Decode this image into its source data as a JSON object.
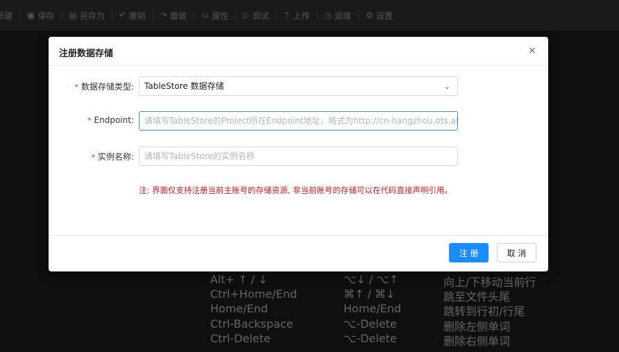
{
  "toolbar": {
    "items": [
      {
        "label": "新建",
        "icon": ""
      },
      {
        "label": "保存",
        "icon": "save-icon"
      },
      {
        "label": "另存为",
        "icon": "save-as-icon"
      },
      {
        "label": "撤销",
        "icon": "undo-icon"
      },
      {
        "label": "重做",
        "icon": "redo-icon"
      },
      {
        "label": "属性",
        "icon": "properties-icon"
      },
      {
        "label": "调试",
        "icon": "debug-icon"
      },
      {
        "label": "上传",
        "icon": "upload-icon"
      },
      {
        "label": "运维",
        "icon": "ops-icon"
      },
      {
        "label": "设置",
        "icon": "gear-icon"
      }
    ]
  },
  "shortcuts": [
    {
      "win": "Alt+ ↑ / ↓",
      "mac": "⌥↓ / ⌥↑",
      "desc": "向上/下移动当前行"
    },
    {
      "win": "Ctrl+Home/End",
      "mac": "⌘↑ / ⌘↓",
      "desc": "跳至文件头尾"
    },
    {
      "win": "Home/End",
      "mac": "Home/End",
      "desc": "跳转到行初/行尾"
    },
    {
      "win": "Ctrl-Backspace",
      "mac": "⌥-Delete",
      "desc": "删除左侧单词"
    },
    {
      "win": "Ctrl-Delete",
      "mac": "⌥-Delete",
      "desc": "删除右侧单词"
    }
  ],
  "dialog": {
    "title": "注册数据存储",
    "close_symbol": "×",
    "fields": {
      "storage_type": {
        "label": "数据存储类型:",
        "value": "TableStore 数据存储"
      },
      "endpoint": {
        "label": "Endpoint:",
        "placeholder": "请填写TableStore的Project所在Endpoint地址，格式为http://cn-hangzhou.ots.aliyuncs.com"
      },
      "instance_name": {
        "label": "实例名称:",
        "placeholder": "请填写TableStore的实例名称"
      }
    },
    "required_mark": "*",
    "note": "注: 界面仅支持注册当前主账号的存储资源, 非当前账号的存储可以在代码直接声明引用。",
    "buttons": {
      "register": "注 册",
      "cancel": "取 消"
    }
  },
  "colors": {
    "primary": "#1a8cff",
    "note": "#d9161f",
    "required": "#e03131",
    "overlay_bg": "#1f1f1f"
  }
}
